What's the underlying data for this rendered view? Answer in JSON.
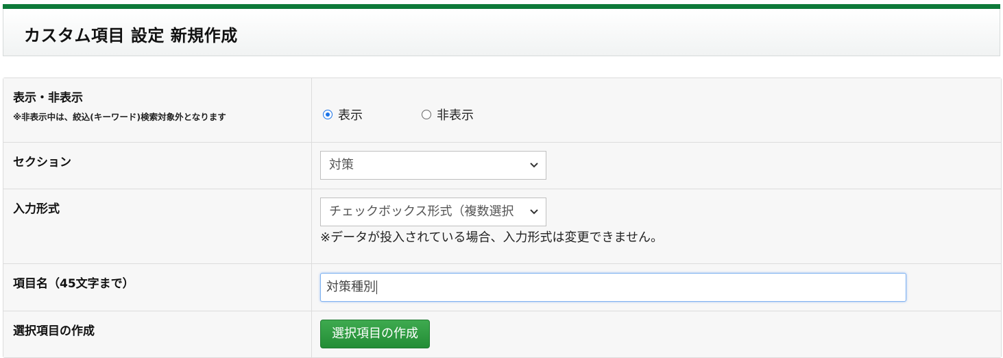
{
  "page": {
    "title": "カスタム項目 設定 新規作成"
  },
  "form": {
    "visibility": {
      "label": "表示・非表示",
      "note": "※非表示中は、絞込(キーワード)検索対象外となります",
      "options": [
        "表示",
        "非表示"
      ],
      "selected": "表示"
    },
    "section": {
      "label": "セクション",
      "selected": "対策"
    },
    "input_format": {
      "label": "入力形式",
      "selected": "チェックボックス形式（複数選択",
      "help": "※データが投入されている場合、入力形式は変更できません。"
    },
    "item_name": {
      "label": "項目名（45文字まで）",
      "value": "対策種別"
    },
    "choices": {
      "label": "選択項目の作成",
      "button_label": "選択項目の作成"
    }
  },
  "colors": {
    "accent_bar": "#0e7a3a",
    "button": "#2e9b40",
    "focus": "#7fb2f0"
  }
}
